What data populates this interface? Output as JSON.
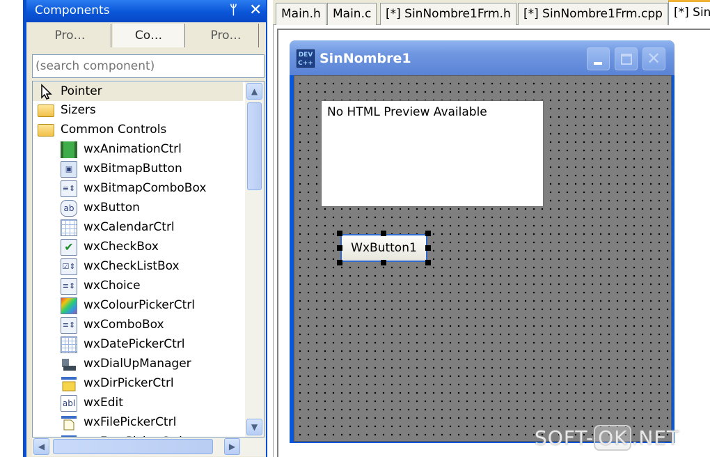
{
  "components_panel": {
    "title": "Components",
    "tabs": [
      "Pro…",
      "Co…",
      "Pro…"
    ],
    "search_placeholder": "(search component)",
    "tree_items": [
      {
        "label": "Pointer",
        "icon": "pointer-icon"
      },
      {
        "label": "Sizers",
        "icon": "folder-icon"
      },
      {
        "label": "Common Controls",
        "icon": "folder-icon"
      },
      {
        "label": "wxAnimationCtrl",
        "icon": "animation-ctrl-icon"
      },
      {
        "label": "wxBitmapButton",
        "icon": "bitmap-button-icon"
      },
      {
        "label": "wxBitmapComboBox",
        "icon": "bitmap-combobox-icon"
      },
      {
        "label": "wxButton",
        "icon": "button-icon"
      },
      {
        "label": "wxCalendarCtrl",
        "icon": "calendar-icon"
      },
      {
        "label": "wxCheckBox",
        "icon": "checkbox-icon"
      },
      {
        "label": "wxCheckListBox",
        "icon": "checklistbox-icon"
      },
      {
        "label": "wxChoice",
        "icon": "choice-icon"
      },
      {
        "label": "wxColourPickerCtrl",
        "icon": "colour-picker-icon"
      },
      {
        "label": "wxComboBox",
        "icon": "combobox-icon"
      },
      {
        "label": "wxDatePickerCtrl",
        "icon": "date-picker-icon"
      },
      {
        "label": "wxDialUpManager",
        "icon": "dialup-manager-icon"
      },
      {
        "label": "wxDirPickerCtrl",
        "icon": "dir-picker-icon"
      },
      {
        "label": "wxEdit",
        "icon": "edit-icon"
      },
      {
        "label": "wxFilePickerCtrl",
        "icon": "file-picker-icon"
      },
      {
        "label": "wxFontPickerCtrl",
        "icon": "font-picker-icon"
      }
    ]
  },
  "editor_tabs": [
    "Main.h",
    "Main.c",
    "[*] SinNombre1Frm.h",
    "[*] SinNombre1Frm.cpp",
    "[*] Sin"
  ],
  "form": {
    "title": "SinNombre1",
    "icon_text": "DEV C++",
    "html_preview_text": "No HTML Preview Available",
    "button_label": "WxButton1"
  },
  "watermark": {
    "left": "SOFT-",
    "mid": "OK",
    "right": ".NET"
  },
  "colors": {
    "xp_blue": "#0a56d8",
    "panel_bg": "#ece9d8",
    "tab_accent": "#f0b232",
    "canvas_grey": "#7f7f7f"
  }
}
